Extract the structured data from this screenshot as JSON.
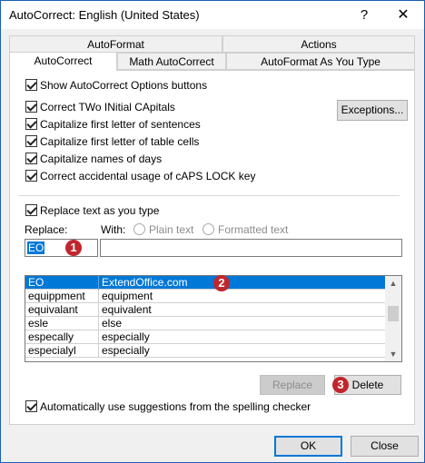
{
  "window": {
    "title": "AutoCorrect: English (United States)",
    "help_label": "?",
    "close_label": "✕"
  },
  "tabs": {
    "row1": [
      {
        "label": "AutoFormat"
      },
      {
        "label": "Actions"
      }
    ],
    "row2": [
      {
        "label": "AutoCorrect",
        "active": true
      },
      {
        "label": "Math AutoCorrect"
      },
      {
        "label": "AutoFormat As You Type"
      }
    ]
  },
  "options": {
    "show_buttons": "Show AutoCorrect Options buttons",
    "correct_two_initial": "Correct TWo INitial CApitals",
    "capitalize_sentences": "Capitalize first letter of sentences",
    "capitalize_table_cells": "Capitalize first letter of table cells",
    "capitalize_days": "Capitalize names of days",
    "correct_caps_lock": "Correct accidental usage of cAPS LOCK key",
    "exceptions_label": "Exceptions..."
  },
  "replace_section": {
    "checkbox_label": "Replace text as you type",
    "replace_label": "Replace:",
    "with_label": "With:",
    "plain_text_label": "Plain text",
    "formatted_text_label": "Formatted text",
    "replace_value": "EO",
    "with_value": ""
  },
  "entries": [
    {
      "replace": "EO",
      "with": "ExtendOffice.com"
    },
    {
      "replace": "equippment",
      "with": "equipment"
    },
    {
      "replace": "equivalant",
      "with": "equivalent"
    },
    {
      "replace": "esle",
      "with": "else"
    },
    {
      "replace": "especally",
      "with": "especially"
    },
    {
      "replace": "especialyl",
      "with": "especially"
    }
  ],
  "buttons": {
    "replace_label": "Replace",
    "delete_label": "Delete",
    "ok_label": "OK",
    "close_label": "Close"
  },
  "suggestions_label": "Automatically use suggestions from the spelling checker",
  "badges": {
    "one": "1",
    "two": "2",
    "three": "3"
  },
  "colors": {
    "selection": "#0078d7",
    "badge": "#c0262d",
    "focus_border": "#0078d7"
  }
}
